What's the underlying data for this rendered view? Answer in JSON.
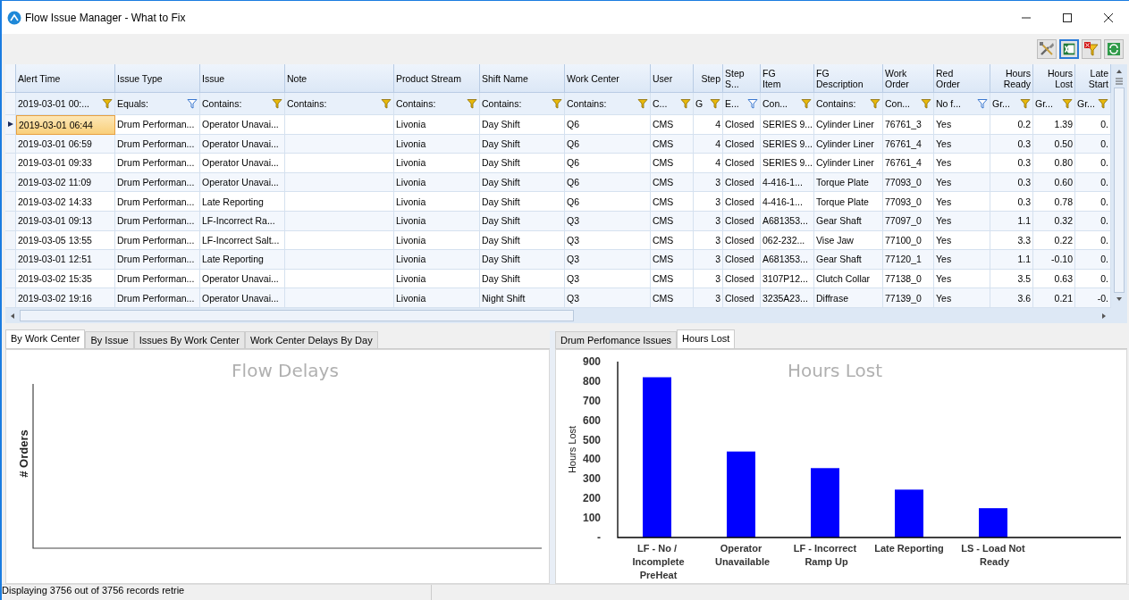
{
  "window": {
    "title": "Flow Issue Manager - What to Fix"
  },
  "grid": {
    "columns": [
      {
        "label": "Alert Time",
        "kind": "text",
        "filter": "2019-03-01  00:...",
        "filter_active": true
      },
      {
        "label": "Issue Type",
        "kind": "text",
        "filter": "Equals:",
        "filter_active": false
      },
      {
        "label": "Issue",
        "kind": "text",
        "filter": "Contains:",
        "filter_active": true
      },
      {
        "label": "Note",
        "kind": "text",
        "filter": "Contains:",
        "filter_active": true
      },
      {
        "label": "Product Stream",
        "kind": "text",
        "filter": "Contains:",
        "filter_active": true
      },
      {
        "label": "Shift Name",
        "kind": "text",
        "filter": "Contains:",
        "filter_active": true
      },
      {
        "label": "Work Center",
        "kind": "text",
        "filter": "Contains:",
        "filter_active": true
      },
      {
        "label": "User",
        "kind": "text",
        "filter": "C...",
        "filter_active": true
      },
      {
        "label": "Step",
        "kind": "number",
        "filter": "G",
        "filter_active": true
      },
      {
        "label": "Step S...",
        "kind": "text",
        "filter": "E...",
        "filter_active": false
      },
      {
        "label": "FG\nItem",
        "kind": "text",
        "filter": "Con...",
        "filter_active": true
      },
      {
        "label": "FG\nDescription",
        "kind": "text",
        "filter": "Contains:",
        "filter_active": true
      },
      {
        "label": "Work\nOrder",
        "kind": "text",
        "filter": "Con...",
        "filter_active": true
      },
      {
        "label": "Red\nOrder",
        "kind": "text",
        "filter": "No f...",
        "filter_active": false
      },
      {
        "label": "Hours\nReady",
        "kind": "number",
        "filter": "Gr...",
        "filter_active": true
      },
      {
        "label": "Hours\nLost",
        "kind": "number",
        "filter": "Gr...",
        "filter_active": true
      },
      {
        "label": "Late\nStart",
        "kind": "number",
        "filter": "Gr...",
        "filter_active": true
      }
    ],
    "rows": [
      {
        "selected": true,
        "cells": [
          "2019-03-01 06:44",
          "Drum Performan...",
          "Operator Unavai...",
          null,
          "Livonia",
          "Day Shift",
          "Q6",
          "CMS",
          "4",
          "Closed",
          "SERIES 9...",
          "Cylinder Liner",
          "76761_3",
          "Yes",
          "0.2",
          "1.39",
          "0."
        ]
      },
      {
        "selected": false,
        "cells": [
          "2019-03-01 06:59",
          "Drum Performan...",
          "Operator Unavai...",
          null,
          "Livonia",
          "Day Shift",
          "Q6",
          "CMS",
          "4",
          "Closed",
          "SERIES 9...",
          "Cylinder Liner",
          "76761_4",
          "Yes",
          "0.3",
          "0.50",
          "0."
        ]
      },
      {
        "selected": false,
        "cells": [
          "2019-03-01 09:33",
          "Drum Performan...",
          "Operator Unavai...",
          null,
          "Livonia",
          "Day Shift",
          "Q6",
          "CMS",
          "4",
          "Closed",
          "SERIES 9...",
          "Cylinder Liner",
          "76761_4",
          "Yes",
          "0.3",
          "0.80",
          "0."
        ]
      },
      {
        "selected": false,
        "cells": [
          "2019-03-02 11:09",
          "Drum Performan...",
          "Operator Unavai...",
          null,
          "Livonia",
          "Day Shift",
          "Q6",
          "CMS",
          "3",
          "Closed",
          "4-416-1...",
          "Torque Plate",
          "77093_0",
          "Yes",
          "0.3",
          "0.60",
          "0."
        ]
      },
      {
        "selected": false,
        "cells": [
          "2019-03-02 14:33",
          "Drum Performan...",
          "Late Reporting",
          null,
          "Livonia",
          "Day Shift",
          "Q6",
          "CMS",
          "3",
          "Closed",
          "4-416-1...",
          "Torque Plate",
          "77093_0",
          "Yes",
          "0.3",
          "0.78",
          "0."
        ]
      },
      {
        "selected": false,
        "cells": [
          "2019-03-01 09:13",
          "Drum Performan...",
          "LF-Incorrect Ra...",
          null,
          "Livonia",
          "Day Shift",
          "Q3",
          "CMS",
          "3",
          "Closed",
          "A681353...",
          "Gear Shaft",
          "77097_0",
          "Yes",
          "1.1",
          "0.32",
          "0."
        ]
      },
      {
        "selected": false,
        "cells": [
          "2019-03-05 13:55",
          "Drum Performan...",
          "LF-Incorrect Salt...",
          null,
          "Livonia",
          "Day Shift",
          "Q3",
          "CMS",
          "3",
          "Closed",
          "062-232...",
          "Vise Jaw",
          "77100_0",
          "Yes",
          "3.3",
          "0.22",
          "0."
        ]
      },
      {
        "selected": false,
        "cells": [
          "2019-03-01 12:51",
          "Drum Performan...",
          "Late Reporting",
          null,
          "Livonia",
          "Day Shift",
          "Q3",
          "CMS",
          "3",
          "Closed",
          "A681353...",
          "Gear Shaft",
          "77120_1",
          "Yes",
          "1.1",
          "-0.10",
          "0."
        ]
      },
      {
        "selected": false,
        "cells": [
          "2019-03-02 15:35",
          "Drum Performan...",
          "Operator Unavai...",
          null,
          "Livonia",
          "Day Shift",
          "Q3",
          "CMS",
          "3",
          "Closed",
          "3107P12...",
          "Clutch Collar",
          "77138_0",
          "Yes",
          "3.5",
          "0.63",
          "0."
        ]
      },
      {
        "selected": false,
        "cells": [
          "2019-03-02 19:16",
          "Drum Performan...",
          "Operator Unavai...",
          null,
          "Livonia",
          "Night Shift",
          "Q3",
          "CMS",
          "3",
          "Closed",
          "3235A23...",
          "Diffrase",
          "77139_0",
          "Yes",
          "3.6",
          "0.21",
          "-0."
        ]
      }
    ]
  },
  "left_panel": {
    "tabs": [
      {
        "label": "By Work Center",
        "selected": true
      },
      {
        "label": "By Issue",
        "selected": false
      },
      {
        "label": "Issues By Work Center",
        "selected": false
      },
      {
        "label": "Work Center Delays By Day",
        "selected": false
      }
    ],
    "chart": {
      "title": "Flow Delays",
      "ylabel": "# Orders"
    }
  },
  "right_panel": {
    "tabs": [
      {
        "label": "Drum Perfomance Issues",
        "selected": false
      },
      {
        "label": "Hours Lost",
        "selected": true
      }
    ],
    "chart_data": {
      "type": "bar",
      "title": "Hours Lost",
      "ylabel": "Hours Lost",
      "categories": [
        "LF - No / Incomplete PreHeat",
        "Operator Unavailable",
        "LF - Incorrect Ramp Up",
        "Late Reporting",
        "LS - Load Not Ready"
      ],
      "series": [
        {
          "color": "#0000ff",
          "values": [
            820,
            440,
            355,
            245,
            150
          ]
        }
      ],
      "ylim": [
        0,
        900
      ],
      "yticks": [
        {
          "value": 0,
          "label": "-"
        },
        100,
        200,
        300,
        400,
        500,
        600,
        700,
        800,
        900
      ]
    }
  },
  "status_bar": {
    "text": "Displaying 3756 out of 3756 records retrie"
  }
}
